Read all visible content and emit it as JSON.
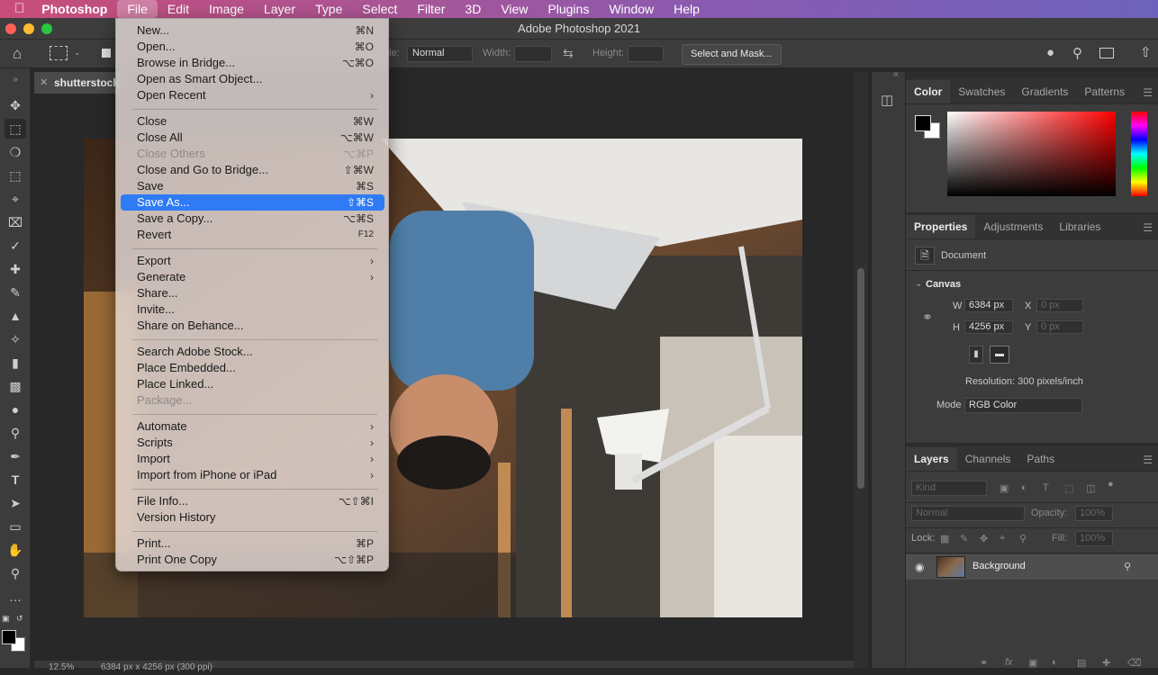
{
  "mac_menubar": {
    "apple": "",
    "app_name": "Photoshop",
    "items": [
      "File",
      "Edit",
      "Image",
      "Layer",
      "Type",
      "Select",
      "Filter",
      "3D",
      "View",
      "Plugins",
      "Window",
      "Help"
    ]
  },
  "window": {
    "title": "Adobe Photoshop 2021"
  },
  "options_bar": {
    "style_label": "le:",
    "style_value": "Normal",
    "width_label": "Width:",
    "height_label": "Height:",
    "select_mask_button": "Select and Mask..."
  },
  "document": {
    "tab_title": "shutterstock",
    "zoom": "12.5%",
    "status": "6384 px x 4256 px (300 ppi)"
  },
  "file_menu": {
    "items": [
      {
        "label": "New...",
        "shortcut": "⌘N"
      },
      {
        "label": "Open...",
        "shortcut": "⌘O"
      },
      {
        "label": "Browse in Bridge...",
        "shortcut": "⌥⌘O"
      },
      {
        "label": "Open as Smart Object...",
        "shortcut": ""
      },
      {
        "label": "Open Recent",
        "shortcut": "›"
      },
      {
        "label": "Close",
        "shortcut": "⌘W"
      },
      {
        "label": "Close All",
        "shortcut": "⌥⌘W"
      },
      {
        "label": "Close Others",
        "shortcut": "⌥⌘P"
      },
      {
        "label": "Close and Go to Bridge...",
        "shortcut": "⇧⌘W"
      },
      {
        "label": "Save",
        "shortcut": "⌘S"
      },
      {
        "label": "Save As...",
        "shortcut": "⇧⌘S"
      },
      {
        "label": "Save a Copy...",
        "shortcut": "⌥⌘S"
      },
      {
        "label": "Revert",
        "shortcut": "F12"
      },
      {
        "label": "Export",
        "shortcut": "›"
      },
      {
        "label": "Generate",
        "shortcut": "›"
      },
      {
        "label": "Share...",
        "shortcut": ""
      },
      {
        "label": "Invite...",
        "shortcut": ""
      },
      {
        "label": "Share on Behance...",
        "shortcut": ""
      },
      {
        "label": "Search Adobe Stock...",
        "shortcut": ""
      },
      {
        "label": "Place Embedded...",
        "shortcut": ""
      },
      {
        "label": "Place Linked...",
        "shortcut": ""
      },
      {
        "label": "Package...",
        "shortcut": ""
      },
      {
        "label": "Automate",
        "shortcut": "›"
      },
      {
        "label": "Scripts",
        "shortcut": "›"
      },
      {
        "label": "Import",
        "shortcut": "›"
      },
      {
        "label": "Import from iPhone or iPad",
        "shortcut": "›"
      },
      {
        "label": "File Info...",
        "shortcut": "⌥⇧⌘I"
      },
      {
        "label": "Version History",
        "shortcut": ""
      },
      {
        "label": "Print...",
        "shortcut": "⌘P"
      },
      {
        "label": "Print One Copy",
        "shortcut": "⌥⇧⌘P"
      }
    ]
  },
  "color_panel": {
    "tabs": [
      "Color",
      "Swatches",
      "Gradients",
      "Patterns"
    ]
  },
  "properties_panel": {
    "tabs": [
      "Properties",
      "Adjustments",
      "Libraries"
    ],
    "doc_label": "Document",
    "section": "Canvas",
    "w_label": "W",
    "w_value": "6384 px",
    "h_label": "H",
    "h_value": "4256 px",
    "x_label": "X",
    "x_value": "0 px",
    "y_label": "Y",
    "y_value": "0 px",
    "resolution": "Resolution: 300 pixels/inch",
    "mode_label": "Mode",
    "mode_value": "RGB Color"
  },
  "layers_panel": {
    "tabs": [
      "Layers",
      "Channels",
      "Paths"
    ],
    "kind": "Kind",
    "blend": "Normal",
    "opacity_label": "Opacity:",
    "opacity_value": "100%",
    "lock_label": "Lock:",
    "fill_label": "Fill:",
    "fill_value": "100%",
    "layer_name": "Background"
  }
}
